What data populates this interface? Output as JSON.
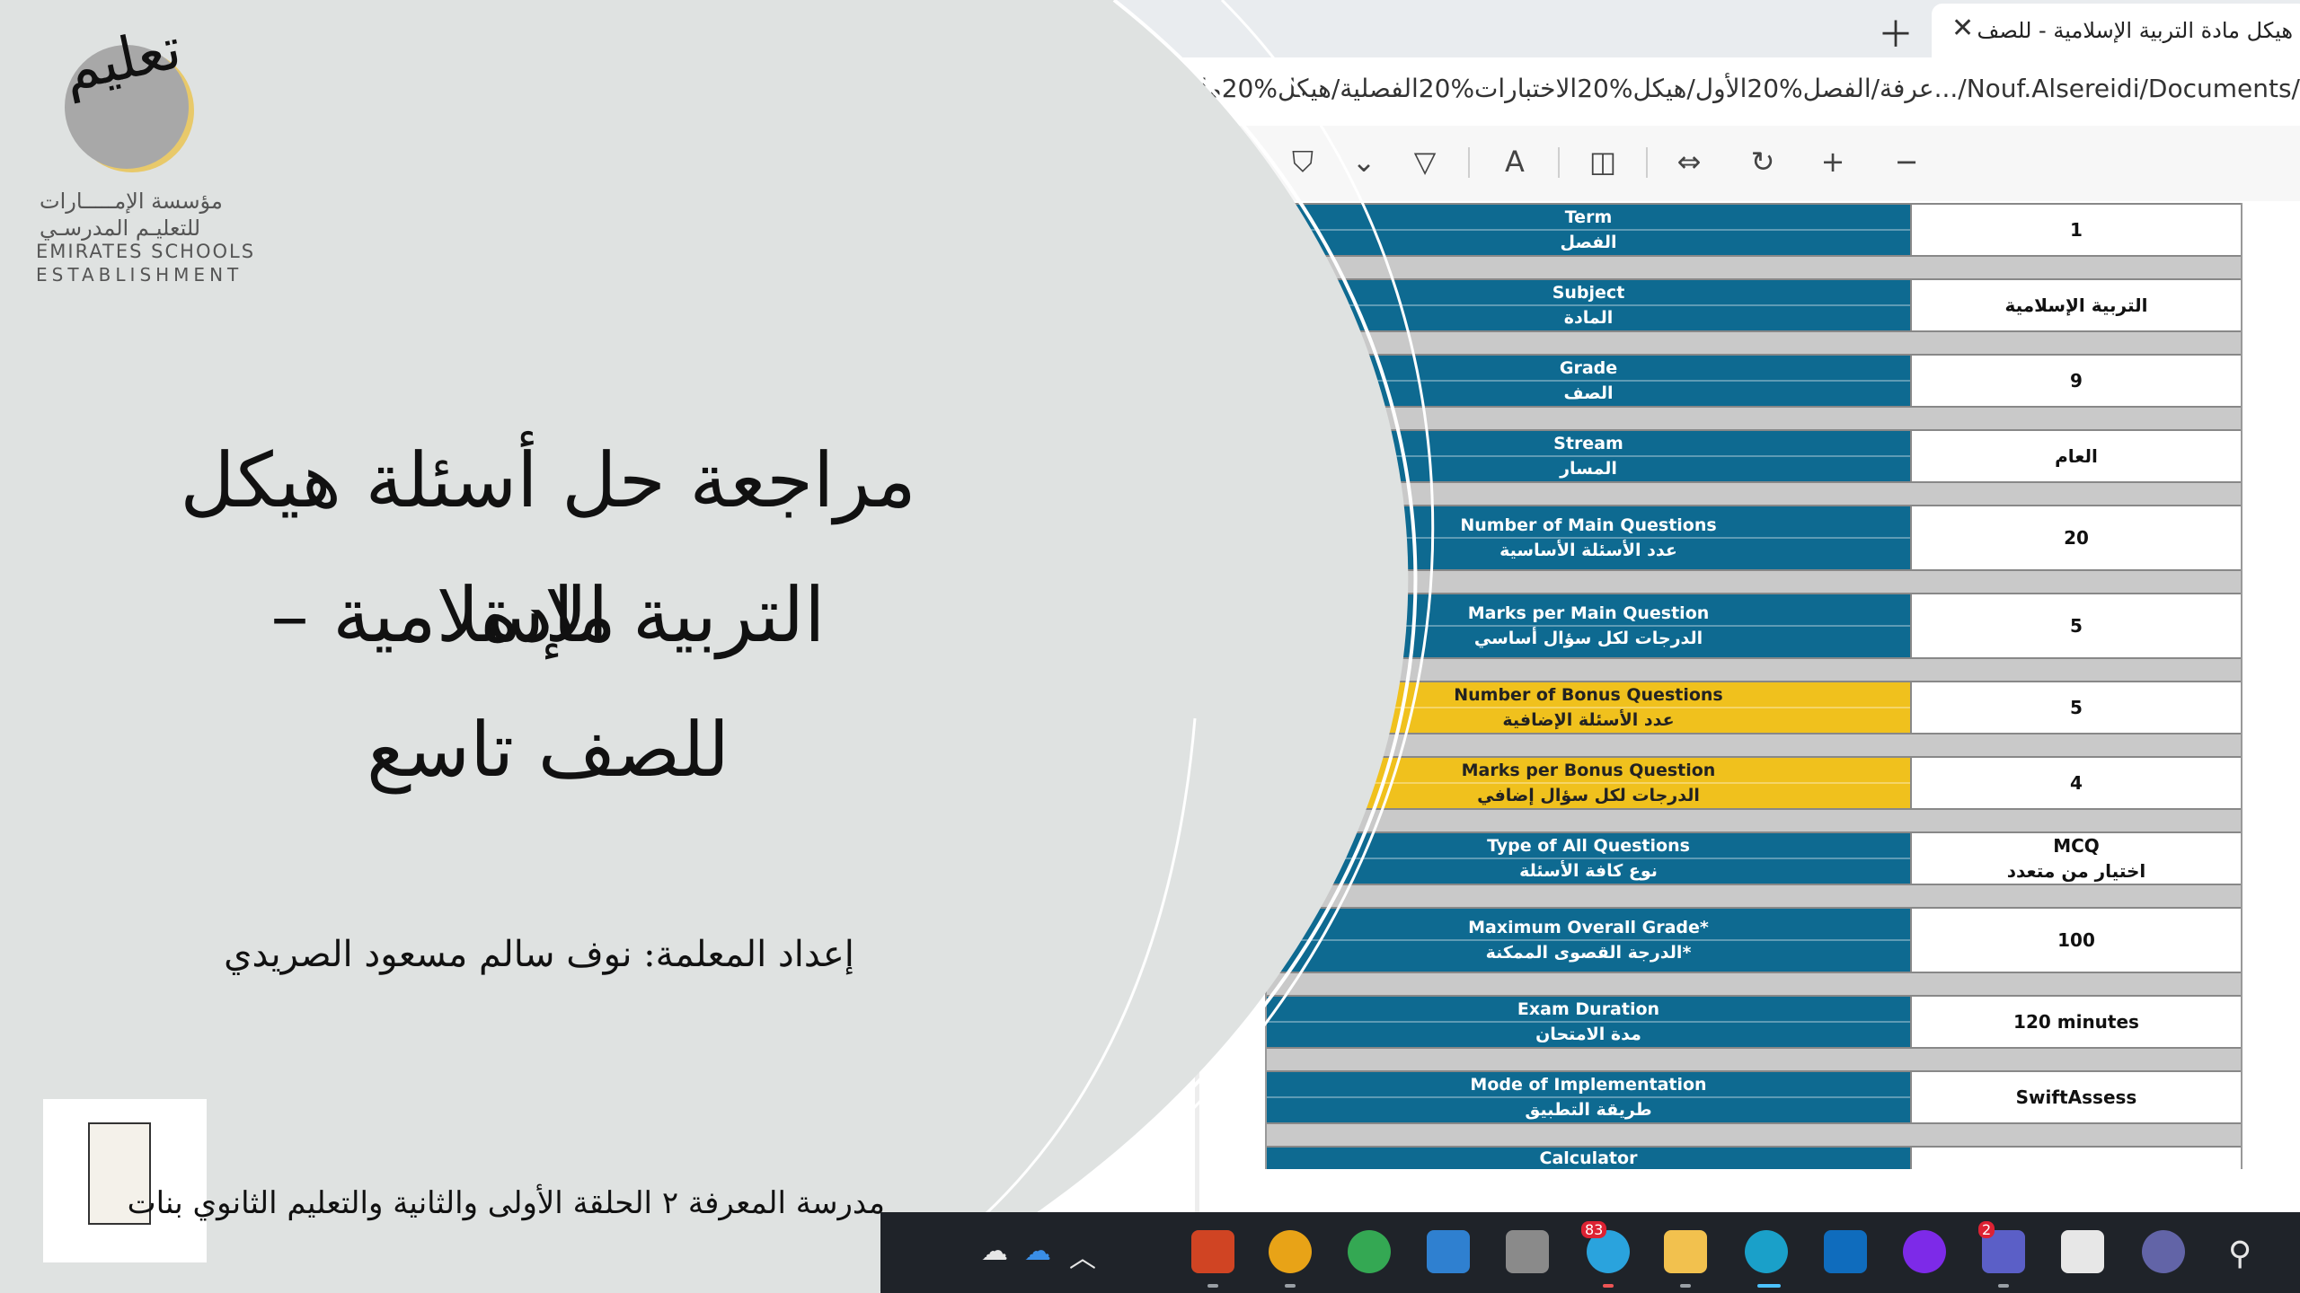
{
  "browser": {
    "tab_title": "هيكل مادة التربية الإسلامية - للصف",
    "address": "عرفة/الفصل%20الأول/هيكل%20الاختبارات%20الفصلية/هيكل%20مادة%20التر.../Nouf.Alsereidi/Documents/"
  },
  "exam_table": {
    "rows": [
      {
        "label_en": "Term",
        "label_ar": "الفصل",
        "value": "1",
        "color": "blue"
      },
      {
        "label_en": "Subject",
        "label_ar": "المادة",
        "value": "التربية الإسلامية",
        "color": "blue"
      },
      {
        "label_en": "Grade",
        "label_ar": "الصف",
        "value": "9",
        "color": "blue"
      },
      {
        "label_en": "Stream",
        "label_ar": "المسار",
        "value": "العام",
        "color": "blue"
      },
      {
        "label_en": "Number of Main Questions",
        "label_ar": "عدد الأسئلة الأساسية",
        "value": "20",
        "color": "blue"
      },
      {
        "label_en": "Marks per Main Question",
        "label_ar": "الدرجات لكل سؤال أساسي",
        "value": "5",
        "color": "blue"
      },
      {
        "label_en": "Number of Bonus Questions",
        "label_ar": "عدد الأسئلة الإضافية",
        "value": "5",
        "color": "gold"
      },
      {
        "label_en": "Marks per Bonus Question",
        "label_ar": "الدرجات لكل سؤال إضافي",
        "value": "4",
        "color": "gold"
      },
      {
        "label_en": "Type of All Questions",
        "label_ar": "نوع كافة الأسئلة",
        "value": "MCQ",
        "value2": "اختيار من متعدد",
        "color": "blue"
      },
      {
        "label_en": "Maximum Overall Grade*",
        "label_ar": "الدرجة القصوى الممكنة*",
        "value": "100",
        "color": "blue"
      },
      {
        "label_en": "Exam Duration",
        "label_ar": "مدة الامتحان",
        "value": "120 minutes",
        "color": "blue"
      },
      {
        "label_en": "Mode of Implementation",
        "label_ar": "طريقة التطبيق",
        "value": "SwiftAssess",
        "color": "blue"
      },
      {
        "label_en": "Calculator",
        "label_ar": "",
        "value": "",
        "color": "blue"
      }
    ]
  },
  "slide": {
    "logo_word": "تعليم",
    "org_ar_1": "مؤسسة الإمـــــارات",
    "org_ar_2": "للتعليـم المدرسـي",
    "org_en_1": "EMIRATES SCHOOLS",
    "org_en_2": "ESTABLISHMENT",
    "title_line1": "مراجعة حل أسئلة هيكل مادة",
    "title_line2": "التربية الإسلامية –",
    "title_line3": "للصف تاسع",
    "author": "إعداد المعلمة: نوف سالم مسعود الصريدي",
    "school": "مدرسة المعرفة ٢ الحلقة الأولى والثانية والتعليم الثانوي بنات"
  },
  "taskbar": {
    "badges": {
      "telegram": "83",
      "teams": "2"
    }
  },
  "colors": {
    "table_blue": "#0e6a91",
    "table_gold": "#f0c11d",
    "slide_bg": "#dfe2e1"
  }
}
